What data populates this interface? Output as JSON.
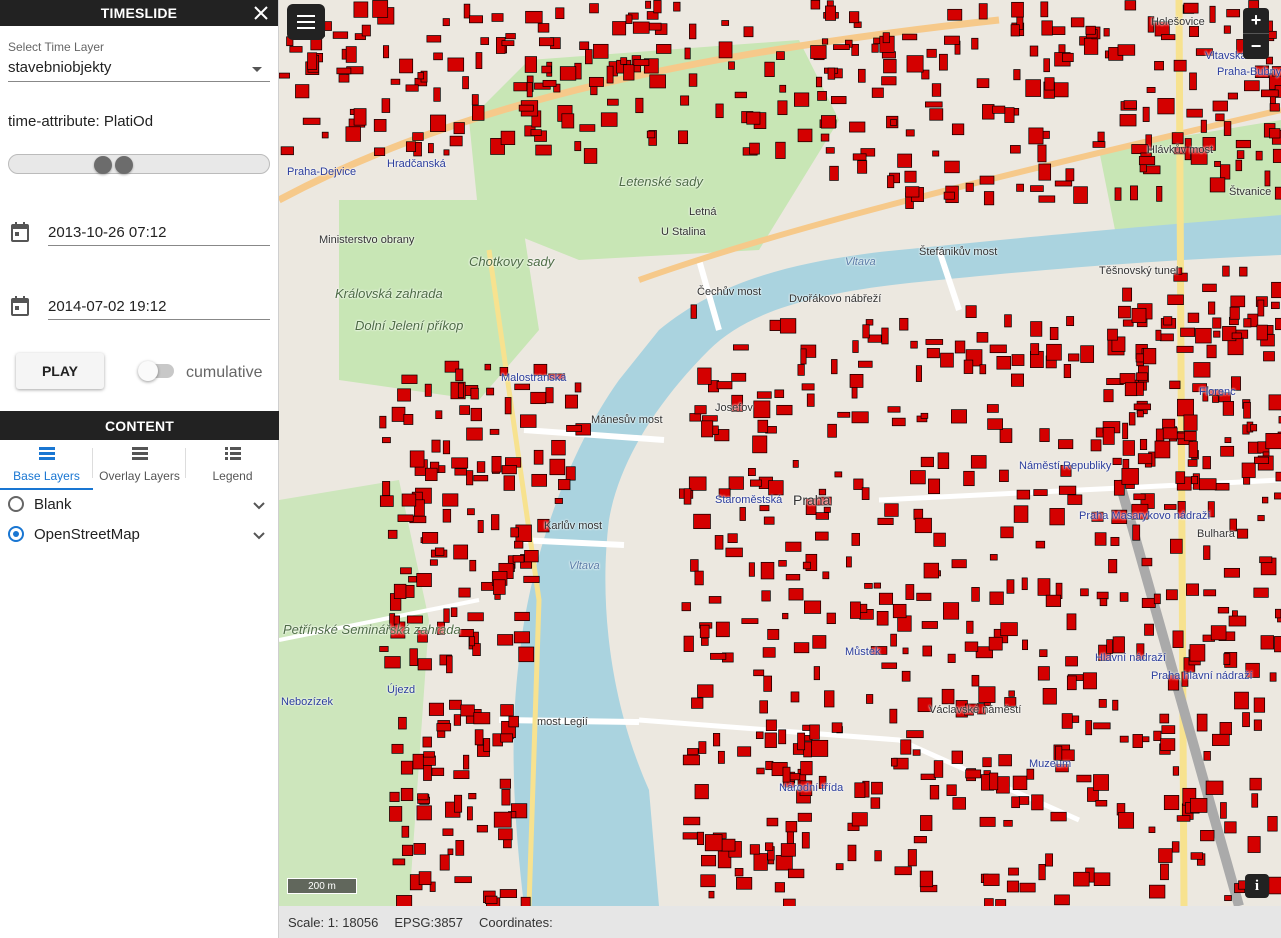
{
  "sidebar": {
    "timeslide_title": "TIMESLIDE",
    "select_label": "Select Time Layer",
    "selected_layer": "stavebniobjekty",
    "time_attribute": "time-attribute: PlatiOd",
    "slider": {
      "min": 0.35,
      "max": 0.44
    },
    "start_date": "2013-10-26 07:12",
    "end_date": "2014-07-02 19:12",
    "play_label": "PLAY",
    "cumulative_label": "cumulative",
    "cumulative_on": false,
    "content_title": "CONTENT",
    "tabs": [
      {
        "label": "Base Layers",
        "icon": "base-layers-icon",
        "active": true
      },
      {
        "label": "Overlay Layers",
        "icon": "overlay-layers-icon",
        "active": false
      },
      {
        "label": "Legend",
        "icon": "legend-icon",
        "active": false
      }
    ],
    "layers": [
      {
        "label": "Blank",
        "selected": false
      },
      {
        "label": "OpenStreetMap",
        "selected": true
      }
    ]
  },
  "map": {
    "scale_bar": "200 m",
    "labels": [
      "Holešovice",
      "Vltavská",
      "Praha-Bubny / Vltavská",
      "Hlávkův most",
      "Štvanice",
      "Letenské sady",
      "Letná",
      "U Stalina",
      "Vltava",
      "Čechův most",
      "Štefánikův most",
      "Dvořákovo nábřeží",
      "Těšnovský tunel",
      "Hradčanská",
      "Praha-Dejvice",
      "Ministerstvo obrany",
      "Chotkovy sady",
      "Královská zahrada",
      "Dolní Jelení příkop",
      "Malostranská",
      "Mánesův most",
      "Josefov",
      "Staroměstská",
      "Praha",
      "Karlův most",
      "Náměstí Republiky",
      "Praha Masarykovo nádraží",
      "Florenc",
      "Hlavní nádraží",
      "Praha hlavní nádraží",
      "Národní třída",
      "Můstek",
      "Václavské náměstí",
      "Muzeum",
      "Petřínské Seminářská zahrada",
      "Újezd",
      "most Legií",
      "Nebozízek",
      "Bulhara",
      "Vltava"
    ]
  },
  "status": {
    "scale": "Scale: 1: 18056",
    "epsg": "EPSG:3857",
    "coordinates": "Coordinates:"
  },
  "colors": {
    "buildings": "#d40000",
    "water": "#aad3df",
    "park": "#c8e6b5",
    "accent": "#1976d2"
  }
}
